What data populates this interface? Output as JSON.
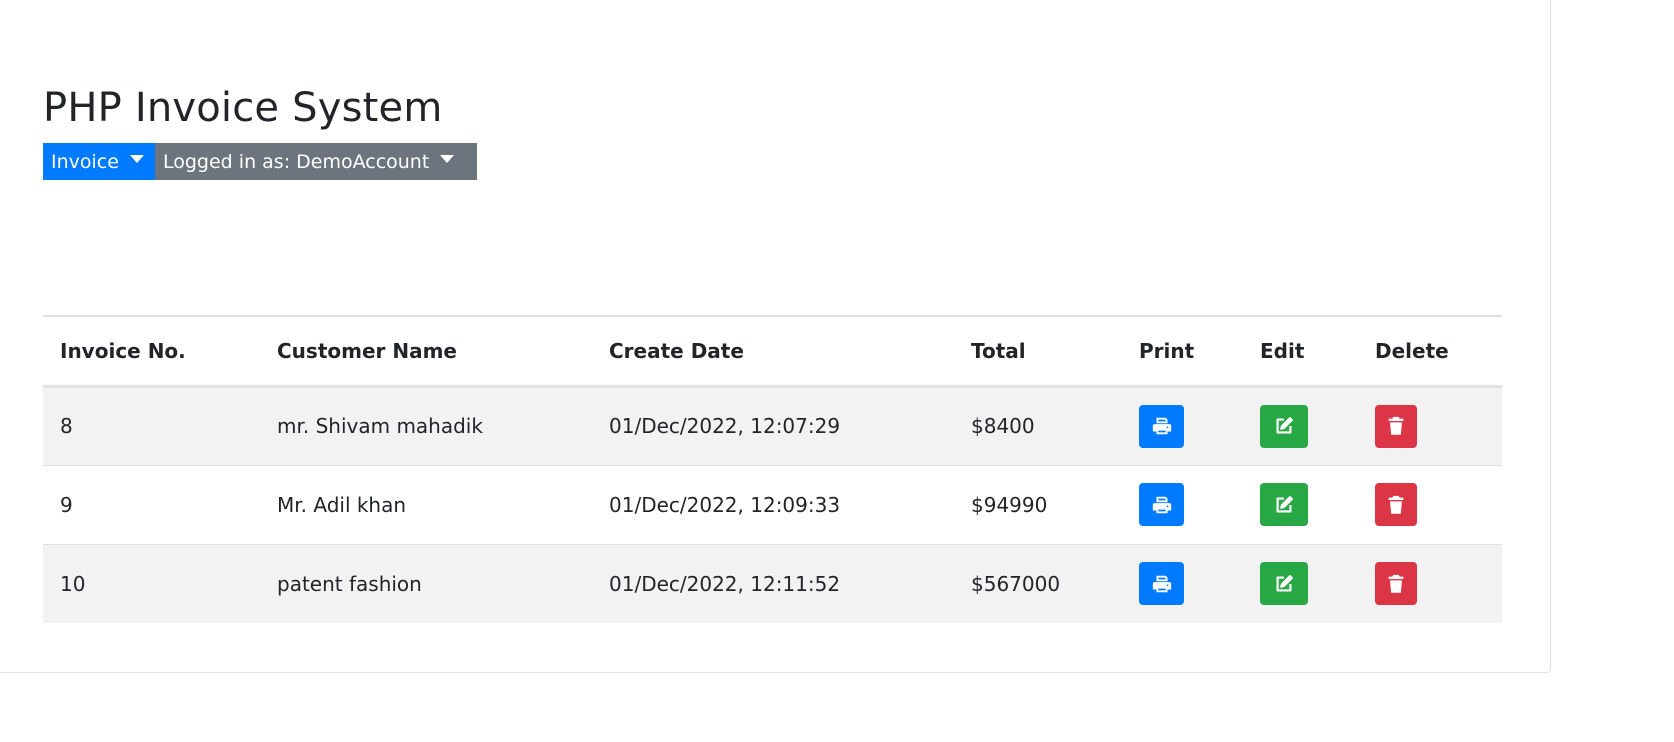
{
  "header": {
    "title": "PHP Invoice System"
  },
  "nav": {
    "invoice_label": "Invoice",
    "account_label": "Logged in as: DemoAccount"
  },
  "table": {
    "columns": [
      "Invoice No.",
      "Customer Name",
      "Create Date",
      "Total",
      "Print",
      "Edit",
      "Delete"
    ],
    "rows": [
      {
        "invoice_no": "8",
        "customer": "mr. Shivam mahadik",
        "date": "01/Dec/2022, 12:07:29",
        "total": "$8400"
      },
      {
        "invoice_no": "9",
        "customer": "Mr. Adil khan",
        "date": "01/Dec/2022, 12:09:33",
        "total": "$94990"
      },
      {
        "invoice_no": "10",
        "customer": "patent fashion",
        "date": "01/Dec/2022, 12:11:52",
        "total": "$567000"
      }
    ]
  },
  "icons": {
    "print": "print-icon",
    "edit": "edit-icon",
    "delete": "trash-icon"
  },
  "colors": {
    "primary": "#007bff",
    "secondary": "#6c757d",
    "success": "#28a745",
    "danger": "#dc3545",
    "stripe": "#f2f2f2"
  }
}
